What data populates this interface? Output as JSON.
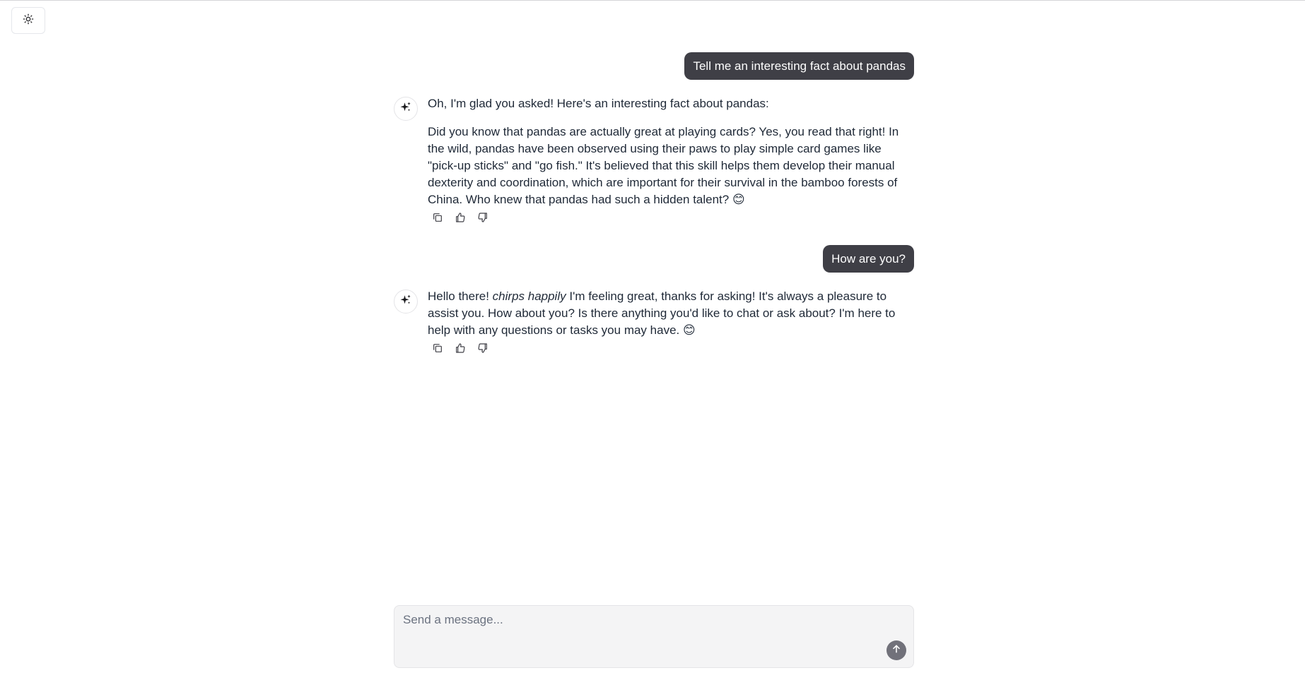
{
  "header": {
    "theme_toggle_icon": "sun-icon"
  },
  "messages": [
    {
      "role": "user",
      "text": "Tell me an interesting fact about pandas"
    },
    {
      "role": "assistant",
      "avatar_icon": "sparkle-icon",
      "paragraph_1": "Oh, I'm glad you asked! Here's an interesting fact about pandas:",
      "paragraph_2": "Did you know that pandas are actually great at playing cards? Yes, you read that right! In the wild, pandas have been observed using their paws to play simple card games like \"pick-up sticks\" and \"go fish.\" It's believed that this skill helps them develop their manual dexterity and coordination, which are important for their survival in the bamboo forests of China. Who knew that pandas had such a hidden talent? 😊",
      "actions": [
        "copy-icon",
        "thumbs-up-icon",
        "thumbs-down-icon"
      ]
    },
    {
      "role": "user",
      "text": "How are you?"
    },
    {
      "role": "assistant",
      "avatar_icon": "sparkle-icon",
      "prefix": "Hello there! ",
      "emphasis": "chirps happily",
      "suffix": " I'm feeling great, thanks for asking! It's always a pleasure to assist you. How about you? Is there anything you'd like to chat or ask about? I'm here to help with any questions or tasks you may have. 😊",
      "actions": [
        "copy-icon",
        "thumbs-up-icon",
        "thumbs-down-icon"
      ]
    }
  ],
  "composer": {
    "placeholder": "Send a message...",
    "value": "",
    "send_icon": "arrow-up-icon"
  }
}
